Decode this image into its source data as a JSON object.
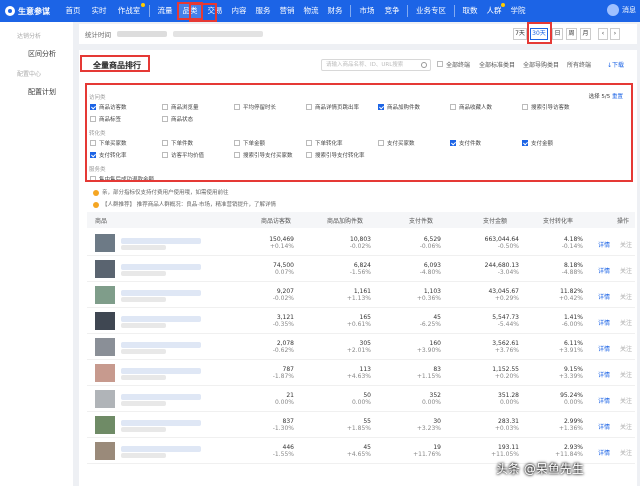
{
  "app": {
    "title": "生意参谋"
  },
  "nav": [
    "首页",
    "实时",
    "作战室",
    "流量",
    "品类",
    "交易",
    "内容",
    "服务",
    "营销",
    "物流",
    "财务",
    "市场",
    "竞争",
    "业务专区",
    "取数",
    "人群",
    "学院"
  ],
  "user": {
    "name": "消息"
  },
  "sidebar": {
    "caption1": "达销分析",
    "item1": "区间分析",
    "caption2": "配置中心",
    "item2": "配置计划"
  },
  "datebar": {
    "label": "统计时间",
    "ranges": [
      "7天",
      "30天",
      "日",
      "周",
      "月"
    ]
  },
  "panel": {
    "title": "全量商品排行",
    "search_placeholder": "请输入商品名称、ID、URL搜索",
    "opt_check": "全部终端",
    "opt1": "全部标准类目",
    "opt2": "全部导购类目",
    "opt3": "所有终端",
    "download": "下载"
  },
  "filters": {
    "selected": "选择 5/5",
    "reset": "重置",
    "group1": "访问类",
    "group2": "转化类",
    "group3": "服务类",
    "row1": [
      {
        "label": "商品访客数",
        "checked": true
      },
      {
        "label": "商品浏览量",
        "checked": false
      },
      {
        "label": "平均停留时长",
        "checked": false
      },
      {
        "label": "商品详情页跳出率",
        "checked": false
      },
      {
        "label": "商品加购件数",
        "checked": true
      },
      {
        "label": "商品收藏人数",
        "checked": false
      },
      {
        "label": "搜索引导访客数",
        "checked": false
      }
    ],
    "row2": [
      {
        "label": "商品标签",
        "checked": false
      },
      {
        "label": "商品状态",
        "checked": false
      }
    ],
    "row3": [
      {
        "label": "下单买家数",
        "checked": false
      },
      {
        "label": "下单件数",
        "checked": false
      },
      {
        "label": "下单金额",
        "checked": false
      },
      {
        "label": "下单转化率",
        "checked": false
      },
      {
        "label": "支付买家数",
        "checked": false
      },
      {
        "label": "支付件数",
        "checked": true
      },
      {
        "label": "支付金额",
        "checked": true
      }
    ],
    "row4": [
      {
        "label": "支付转化率",
        "checked": true
      },
      {
        "label": "访客平均价值",
        "checked": false
      },
      {
        "label": "搜索引导支付买家数",
        "checked": false
      },
      {
        "label": "搜索引导支付转化率",
        "checked": false
      }
    ],
    "row5": [
      {
        "label": "售中售后成功退款金额",
        "checked": false
      }
    ]
  },
  "notices": [
    "亲，部分指标仅支持付费用户使用哦，如需使用前往",
    "【人群推荐】 推荐商品人群概况：良品·市场，精准营销提升，了解详情"
  ],
  "table": {
    "headers": [
      "商品",
      "商品访客数",
      "商品加购件数",
      "支付件数",
      "支付金额",
      "支付转化率",
      "操作"
    ],
    "detail": "详情",
    "follow": "关注",
    "rows": [
      {
        "cells": [
          [
            "150,469",
            "+0.14%"
          ],
          [
            "10,803",
            "-0.02%"
          ],
          [
            "6,529",
            "-0.06%"
          ],
          [
            "663,044.64",
            "-0.50%"
          ],
          [
            "4.18%",
            "-0.14%"
          ]
        ],
        "thumb": "#6d7a86"
      },
      {
        "cells": [
          [
            "74,500",
            "0.07%"
          ],
          [
            "6,824",
            "-1.56%"
          ],
          [
            "6,093",
            "-4.80%"
          ],
          [
            "244,680.13",
            "-3.04%"
          ],
          [
            "8.18%",
            "-4.88%"
          ]
        ],
        "thumb": "#5a6470"
      },
      {
        "cells": [
          [
            "9,207",
            "-0.02%"
          ],
          [
            "1,161",
            "+1.13%"
          ],
          [
            "1,103",
            "+0.36%"
          ],
          [
            "43,045.67",
            "+0.29%"
          ],
          [
            "11.82%",
            "+0.42%"
          ]
        ],
        "thumb": "#7f9d8a"
      },
      {
        "cells": [
          [
            "3,121",
            "-0.35%"
          ],
          [
            "165",
            "+0.61%"
          ],
          [
            "45",
            "-6.25%"
          ],
          [
            "5,547.73",
            "-5.44%"
          ],
          [
            "1.41%",
            "-6.00%"
          ]
        ],
        "thumb": "#3f4752"
      },
      {
        "cells": [
          [
            "2,078",
            "-0.62%"
          ],
          [
            "305",
            "+2.01%"
          ],
          [
            "160",
            "+3.90%"
          ],
          [
            "3,562.61",
            "+3.76%"
          ],
          [
            "6.11%",
            "+3.91%"
          ]
        ],
        "thumb": "#8a8f97"
      },
      {
        "cells": [
          [
            "787",
            "-1.87%"
          ],
          [
            "113",
            "+4.63%"
          ],
          [
            "83",
            "+1.15%"
          ],
          [
            "1,152.55",
            "+0.20%"
          ],
          [
            "9.15%",
            "+3.39%"
          ]
        ],
        "thumb": "#c79a8e"
      },
      {
        "cells": [
          [
            "21",
            "0.00%"
          ],
          [
            "50",
            "0.00%"
          ],
          [
            "352",
            "0.00%"
          ],
          [
            "351.28",
            "0.00%"
          ],
          [
            "95.24%",
            "0.00%"
          ]
        ],
        "thumb": "#b0b4b8"
      },
      {
        "cells": [
          [
            "837",
            "-1.30%"
          ],
          [
            "55",
            "+1.85%"
          ],
          [
            "30",
            "+3.23%"
          ],
          [
            "283.31",
            "+0.03%"
          ],
          [
            "2.99%",
            "+1.36%"
          ]
        ],
        "thumb": "#6f8b66"
      },
      {
        "cells": [
          [
            "446",
            "-1.55%"
          ],
          [
            "45",
            "+4.65%"
          ],
          [
            "19",
            "+11.76%"
          ],
          [
            "193.11",
            "+11.05%"
          ],
          [
            "2.93%",
            "+11.84%"
          ]
        ],
        "thumb": "#9a8a7a"
      }
    ]
  },
  "watermark": "头条 @呆鱼先生"
}
